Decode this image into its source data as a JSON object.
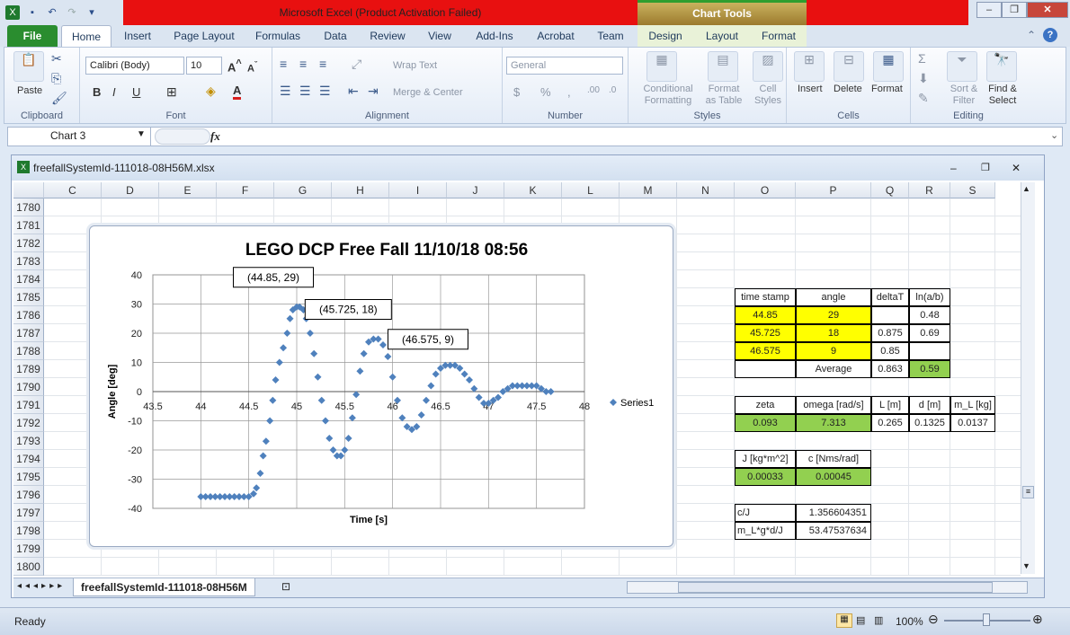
{
  "window": {
    "title": "Microsoft Excel (Product Activation Failed)",
    "context_tab": "Chart Tools"
  },
  "tabs": [
    "File",
    "Home",
    "Insert",
    "Page Layout",
    "Formulas",
    "Data",
    "Review",
    "View",
    "Add-Ins",
    "Acrobat",
    "Team",
    "Design",
    "Layout",
    "Format"
  ],
  "ribbon": {
    "clipboard": {
      "label": "Clipboard",
      "paste": "Paste"
    },
    "font": {
      "label": "Font",
      "name": "Calibri (Body)",
      "size": "10"
    },
    "alignment": {
      "label": "Alignment",
      "wrap": "Wrap Text",
      "merge": "Merge & Center"
    },
    "number": {
      "label": "Number",
      "format": "General"
    },
    "styles": {
      "label": "Styles",
      "conditional": "Conditional Formatting",
      "format_table": "Format as Table",
      "cell_styles": "Cell Styles"
    },
    "cells": {
      "label": "Cells",
      "insert": "Insert",
      "delete": "Delete",
      "format": "Format"
    },
    "editing": {
      "label": "Editing",
      "sort": "Sort & Filter",
      "find": "Find & Select"
    }
  },
  "formula_bar": {
    "name_box": "Chart 3",
    "fx": "fx",
    "value": ""
  },
  "workbook": {
    "filename": "freefallSystemId-111018-08H56M.xlsx",
    "sheet_tab": "freefallSystemId-111018-08H56M"
  },
  "columns": [
    "C",
    "D",
    "E",
    "F",
    "G",
    "H",
    "I",
    "J",
    "K",
    "L",
    "M",
    "N",
    "O",
    "P",
    "Q",
    "R",
    "S"
  ],
  "rows": [
    "1780",
    "1781",
    "1782",
    "1783",
    "1784",
    "1785",
    "1786",
    "1787",
    "1788",
    "1789",
    "1790",
    "1791",
    "1792",
    "1793",
    "1794",
    "1795",
    "1796",
    "1797",
    "1798",
    "1799",
    "1800"
  ],
  "table1": {
    "headers": [
      "time stamp",
      "angle",
      "deltaT",
      "ln(a/b)"
    ],
    "rows": [
      [
        "44.85",
        "29",
        "",
        "0.48"
      ],
      [
        "45.725",
        "18",
        "0.875",
        "0.69"
      ],
      [
        "46.575",
        "9",
        "0.85",
        ""
      ],
      [
        "",
        "Average",
        "0.863",
        "0.59"
      ]
    ]
  },
  "table2": {
    "headers": [
      "zeta",
      "omega [rad/s]",
      "L [m]",
      "d [m]",
      "m_L [kg]"
    ],
    "values": [
      "0.093",
      "7.313",
      "0.265",
      "0.1325",
      "0.0137"
    ]
  },
  "table3": {
    "headers": [
      "J [kg*m^2]",
      "c [Nms/rad]"
    ],
    "values": [
      "0.00033",
      "0.00045"
    ]
  },
  "table4": {
    "rows": [
      [
        "c/J",
        "1.356604351"
      ],
      [
        "m_L*g*d/J",
        "53.47537634"
      ]
    ]
  },
  "chart_data": {
    "type": "scatter",
    "title": "LEGO DCP Free Fall 11/10/18 08:56",
    "xlabel": "Time [s]",
    "ylabel": "Angle [deg]",
    "xlim": [
      43.5,
      48
    ],
    "ylim": [
      -40,
      40
    ],
    "xticks": [
      "43.5",
      "44",
      "44.5",
      "45",
      "45.5",
      "46",
      "46.5",
      "47",
      "47.5",
      "48"
    ],
    "yticks": [
      "40",
      "30",
      "20",
      "10",
      "0",
      "-10",
      "-20",
      "-30",
      "-40"
    ],
    "legend": "right",
    "series": [
      {
        "name": "Series1",
        "color": "#4f81bd"
      }
    ],
    "annotations": [
      {
        "x": 44.85,
        "y": 29,
        "text": "(44.85, 29)"
      },
      {
        "x": 45.725,
        "y": 18,
        "text": "(45.725, 18)"
      },
      {
        "x": 46.575,
        "y": 9,
        "text": "(46.575, 9)"
      }
    ],
    "points": [
      [
        44.0,
        -36
      ],
      [
        44.05,
        -36
      ],
      [
        44.1,
        -36
      ],
      [
        44.15,
        -36
      ],
      [
        44.2,
        -36
      ],
      [
        44.25,
        -36
      ],
      [
        44.3,
        -36
      ],
      [
        44.35,
        -36
      ],
      [
        44.4,
        -36
      ],
      [
        44.45,
        -36
      ],
      [
        44.5,
        -36
      ],
      [
        44.55,
        -35
      ],
      [
        44.58,
        -33
      ],
      [
        44.62,
        -28
      ],
      [
        44.65,
        -22
      ],
      [
        44.68,
        -17
      ],
      [
        44.72,
        -10
      ],
      [
        44.75,
        -3
      ],
      [
        44.78,
        4
      ],
      [
        44.82,
        10
      ],
      [
        44.86,
        15
      ],
      [
        44.9,
        20
      ],
      [
        44.93,
        25
      ],
      [
        44.96,
        28
      ],
      [
        45.0,
        29
      ],
      [
        45.03,
        29
      ],
      [
        45.07,
        28
      ],
      [
        45.1,
        25
      ],
      [
        45.14,
        20
      ],
      [
        45.18,
        13
      ],
      [
        45.22,
        5
      ],
      [
        45.26,
        -3
      ],
      [
        45.3,
        -10
      ],
      [
        45.34,
        -16
      ],
      [
        45.38,
        -20
      ],
      [
        45.42,
        -22
      ],
      [
        45.46,
        -22
      ],
      [
        45.5,
        -20
      ],
      [
        45.54,
        -16
      ],
      [
        45.58,
        -9
      ],
      [
        45.62,
        -1
      ],
      [
        45.66,
        7
      ],
      [
        45.7,
        13
      ],
      [
        45.75,
        17
      ],
      [
        45.8,
        18
      ],
      [
        45.85,
        18
      ],
      [
        45.9,
        16
      ],
      [
        45.95,
        12
      ],
      [
        46.0,
        5
      ],
      [
        46.05,
        -3
      ],
      [
        46.1,
        -9
      ],
      [
        46.15,
        -12
      ],
      [
        46.2,
        -13
      ],
      [
        46.25,
        -12
      ],
      [
        46.3,
        -8
      ],
      [
        46.35,
        -3
      ],
      [
        46.4,
        2
      ],
      [
        46.45,
        6
      ],
      [
        46.5,
        8
      ],
      [
        46.55,
        9
      ],
      [
        46.6,
        9
      ],
      [
        46.65,
        9
      ],
      [
        46.7,
        8
      ],
      [
        46.75,
        6
      ],
      [
        46.8,
        4
      ],
      [
        46.85,
        1
      ],
      [
        46.9,
        -2
      ],
      [
        46.95,
        -4
      ],
      [
        47.0,
        -4
      ],
      [
        47.05,
        -3
      ],
      [
        47.1,
        -2
      ],
      [
        47.15,
        0
      ],
      [
        47.2,
        1
      ],
      [
        47.25,
        2
      ],
      [
        47.3,
        2
      ],
      [
        47.35,
        2
      ],
      [
        47.4,
        2
      ],
      [
        47.45,
        2
      ],
      [
        47.5,
        2
      ],
      [
        47.55,
        1
      ],
      [
        47.6,
        0
      ],
      [
        47.65,
        0
      ]
    ]
  },
  "status": {
    "ready": "Ready",
    "zoom": "100%"
  }
}
